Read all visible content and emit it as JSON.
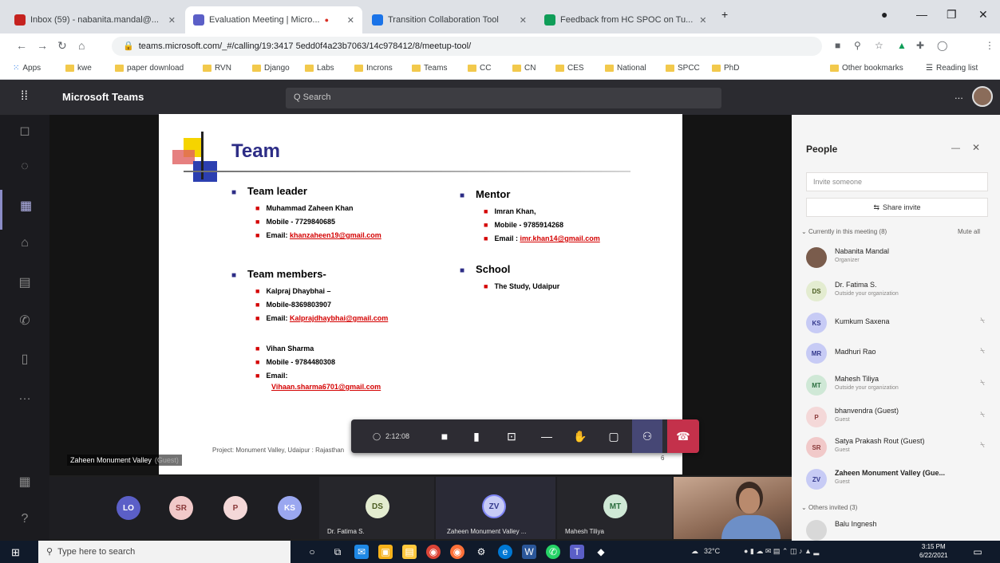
{
  "browser": {
    "tabs": [
      {
        "label": "Inbox (59) - nabanita.mandal@...",
        "color": "#c5221f"
      },
      {
        "label": "Evaluation Meeting | Micro...",
        "color": "#5b5fc7",
        "active": true
      },
      {
        "label": "Transition Collaboration Tool",
        "color": "#1a73e8"
      },
      {
        "label": "Feedback from HC SPOC on Tu...",
        "color": "#0f9d58"
      }
    ],
    "new_tab": "+",
    "url": "teams.microsoft.com/_#/calling/19:3417 5edd0f4a23b7063/14c978412/8/meetup-tool/",
    "bookmarks": [
      "Apps",
      "kwe",
      "paper download",
      "RVN",
      "Django",
      "Labs",
      "Incrons",
      "Teams",
      "CC",
      "CN",
      "CES",
      "National",
      "SPCC",
      "PhD"
    ],
    "other_bookmarks": "Other bookmarks",
    "reading_list": "Reading list"
  },
  "teams": {
    "title": "Microsoft Teams",
    "search_placeholder": "Q Search",
    "more": "...",
    "rail_icons": [
      "activity-icon",
      "chat-icon",
      "teams-icon",
      "assignments-icon",
      "calendar-icon",
      "calls-icon",
      "files-icon",
      "more-icon",
      "apps-icon",
      "help-icon"
    ]
  },
  "slide": {
    "title": "Team",
    "leader_heading": "Team leader",
    "leader": [
      "Muhammad Zaheen Khan",
      "Mobile - 7729840685"
    ],
    "leader_email_label": "Email: ",
    "leader_email": "khanzaheen19@gmail.com",
    "members_heading": "Team members-",
    "member1": [
      "Kalpraj Dhaybhai –",
      "Mobile-8369803907"
    ],
    "member1_email_label": "Email: ",
    "member1_email": "Kalprajdhaybhai@gmail.com",
    "member2": [
      "Vihan Sharma",
      "Mobile - 9784480308"
    ],
    "member2_email_label": "Email:",
    "member2_email": "Vihaan.sharma6701@gmail.com",
    "mentor_heading": "Mentor",
    "mentor": [
      "Imran Khan,",
      "Mobile - 9785914268"
    ],
    "mentor_email_label": "Email : ",
    "mentor_email": "imr.khan14@gmail.com",
    "school_heading": "School",
    "school": "The Study, Udaipur",
    "footer": "Project: Monument Valley, Udaipur : Rajasthan",
    "page": "6"
  },
  "stage": {
    "presenter_name": "Zaheen Monument Valley",
    "presenter_tag": "(Guest)"
  },
  "controls": {
    "timer": "2:12:08",
    "icons": [
      "camera-icon",
      "mic-icon",
      "share-icon",
      "more-actions-icon",
      "raise-hand-icon",
      "chat-icon",
      "participants-icon"
    ],
    "hangup": "☎"
  },
  "strip": {
    "tiles": [
      {
        "initials": "LO",
        "bg": "#5b5fc7",
        "fg": "#ffffff"
      },
      {
        "initials": "SR",
        "bg": "#f1c9c9",
        "fg": "#8a3a3a"
      },
      {
        "initials": "P",
        "bg": "#f4d8d8",
        "fg": "#8a3a3a"
      },
      {
        "initials": "KS",
        "bg": "#9aa7f0",
        "fg": "#ffffff"
      },
      {
        "initials": "DS",
        "bg": "#e3ecd0",
        "fg": "#4a5c20",
        "label": "Dr. Fatima S."
      },
      {
        "initials": "ZV",
        "bg": "#c7cbf5",
        "fg": "#34398c",
        "label": "Zaheen Monument Valley ..."
      },
      {
        "initials": "MT",
        "bg": "#cfe8d6",
        "fg": "#2b6e3f",
        "label": "Mahesh Tiliya"
      }
    ]
  },
  "people": {
    "title": "People",
    "invite_placeholder": "Invite someone",
    "share_invite": "Share invite",
    "in_meeting": "Currently in this meeting (8)",
    "mute_all": "Mute all",
    "participants": [
      {
        "initials": "",
        "name": "Nabanita Mandal",
        "role": "Organizer",
        "bg": "#7a5c4c",
        "fg": "#ffffff",
        "mic": false
      },
      {
        "initials": "DS",
        "name": "Dr. Fatima S.",
        "role": "Outside your organization",
        "bg": "#e3ecd0",
        "fg": "#4a5c20",
        "mic": false
      },
      {
        "initials": "KS",
        "name": "Kumkum Saxena",
        "role": "",
        "bg": "#c7cbf5",
        "fg": "#34398c",
        "mic": true
      },
      {
        "initials": "MR",
        "name": "Madhuri Rao",
        "role": "",
        "bg": "#c7cbf5",
        "fg": "#34398c",
        "mic": true
      },
      {
        "initials": "MT",
        "name": "Mahesh Tiliya",
        "role": "Outside your organization",
        "bg": "#cfe8d6",
        "fg": "#2b6e3f",
        "mic": true
      },
      {
        "initials": "P",
        "name": "bhanvendra (Guest)",
        "role": "Guest",
        "bg": "#f4d8d8",
        "fg": "#8a3a3a",
        "mic": true
      },
      {
        "initials": "SR",
        "name": "Satya Prakash Rout (Guest)",
        "role": "Guest",
        "bg": "#f1c9c9",
        "fg": "#8a3a3a",
        "mic": true
      },
      {
        "initials": "ZV",
        "name": "Zaheen Monument Valley (Gue...",
        "role": "Guest",
        "bg": "#c7cbf5",
        "fg": "#34398c",
        "mic": false
      }
    ],
    "others_invited": "Others invited (3)",
    "others": [
      {
        "initials": "",
        "name": "Balu Ingnesh",
        "bg": "#d8d8d8",
        "fg": "#555"
      }
    ]
  },
  "taskbar": {
    "search_placeholder": "Type here to search",
    "weather": "32°C",
    "time": "3:15 PM",
    "date": "6/22/2021"
  }
}
